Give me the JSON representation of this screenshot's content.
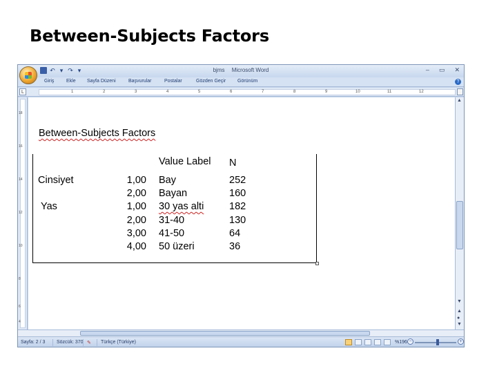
{
  "slide": {
    "title": "Between-Subjects Factors"
  },
  "window": {
    "title_doc": "bjms",
    "title_app": "Microsoft Word",
    "controls": [
      "–",
      "▭",
      "✕"
    ]
  },
  "ribbon": {
    "tabs": [
      "Giriş",
      "Ekle",
      "Sayfa Düzeni",
      "Başvurular",
      "Postalar",
      "Gözden Geçir",
      "Görünüm"
    ]
  },
  "ruler": {
    "h_numbers": [
      "1",
      "2",
      "3",
      "4",
      "5",
      "6",
      "7",
      "8",
      "9",
      "10",
      "11",
      "12"
    ],
    "v_numbers": [
      "18",
      "16",
      "14",
      "12",
      "10",
      "8",
      "6",
      "4"
    ]
  },
  "document": {
    "table_title": "Between-Subjects Factors",
    "headers": {
      "value_label": "Value Label",
      "n": "N"
    },
    "factors": [
      {
        "name": "Cinsiyet",
        "rows": [
          {
            "value": "1,00",
            "label": "Bay",
            "n": "252"
          },
          {
            "value": "2,00",
            "label": "Bayan",
            "n": "160"
          }
        ]
      },
      {
        "name": "Yas",
        "rows": [
          {
            "value": "1,00",
            "label": "30 yas alti",
            "n": "182"
          },
          {
            "value": "2,00",
            "label": "31-40",
            "n": "130"
          },
          {
            "value": "3,00",
            "label": "41-50",
            "n": "64"
          },
          {
            "value": "4,00",
            "label": "50 üzeri",
            "n": "36"
          }
        ]
      }
    ]
  },
  "status": {
    "page": "Sayfa: 2 / 3",
    "words": "Sözcük: 370",
    "language": "Türkçe (Türkiye)",
    "zoom": "%196",
    "zoom_level": 0.55
  },
  "colors": {
    "window_frame": "#c5d5ea",
    "spell_underline": "#d02020"
  }
}
